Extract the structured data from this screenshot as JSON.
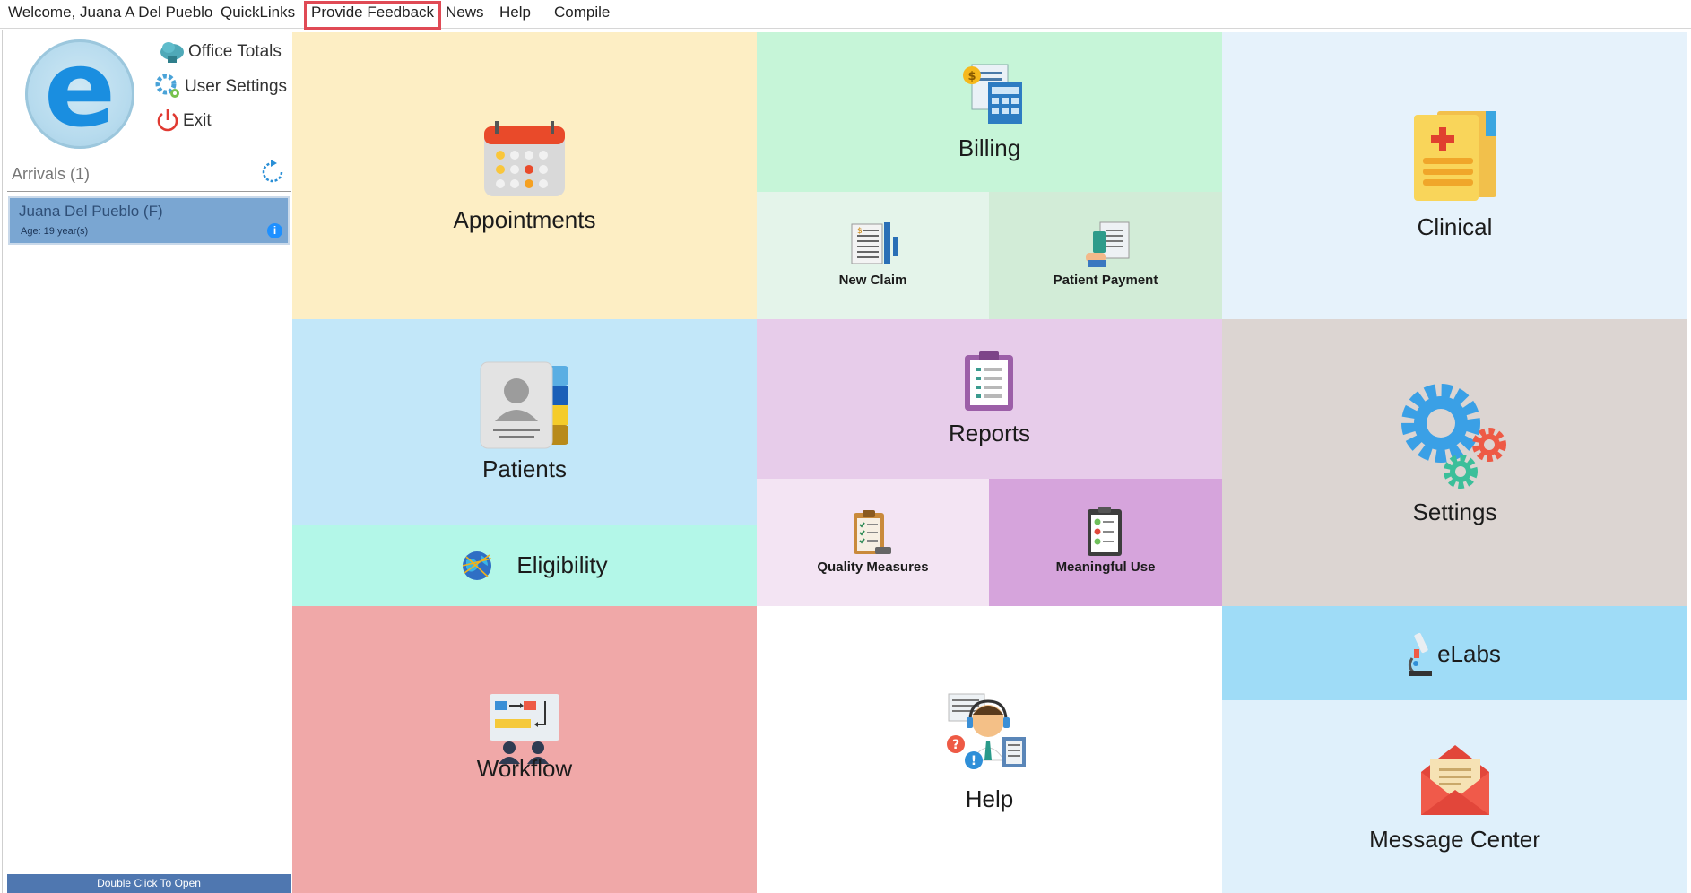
{
  "menu": {
    "welcome": "Welcome, Juana A Del Pueblo",
    "quicklinks": "QuickLinks",
    "feedback": "Provide Feedback",
    "news": "News",
    "help": "Help",
    "compile": "Compile"
  },
  "user_links": {
    "office_totals": "Office Totals",
    "user_settings": "User Settings",
    "exit": "Exit"
  },
  "arrivals": {
    "title": "Arrivals (1)",
    "patient_name": "Juana Del Pueblo (F)",
    "patient_age": "Age: 19 year(s)",
    "info": "i",
    "open_hint": "Double Click To Open"
  },
  "tiles": {
    "appointments": "Appointments",
    "billing": "Billing",
    "new_claim": "New Claim",
    "patient_payment": "Patient Payment",
    "clinical": "Clinical",
    "patients": "Patients",
    "eligibility": "Eligibility",
    "reports": "Reports",
    "quality_measures": "Quality Measures",
    "meaningful_use": "Meaningful Use",
    "settings": "Settings",
    "workflow": "Workflow",
    "help": "Help",
    "elabs": "eLabs",
    "message_center": "Message Center"
  },
  "colors": {
    "appointments": "#fdeec4",
    "billing": "#c6f5d8",
    "new_claim": "#e4f4ea",
    "patient_payment": "#d2ecd7",
    "clinical": "#e6f2fb",
    "patients": "#c2e7f9",
    "eligibility": "#b3f7e8",
    "reports": "#e7ccea",
    "quality_measures": "#f3e4f3",
    "meaningful_use": "#d6a4dc",
    "settings": "#dcd5d2",
    "workflow": "#f0a8a8",
    "help": "#ffffff",
    "elabs": "#9fdcf7",
    "message_center": "#dff0fb",
    "highlight": "#e04a55"
  }
}
